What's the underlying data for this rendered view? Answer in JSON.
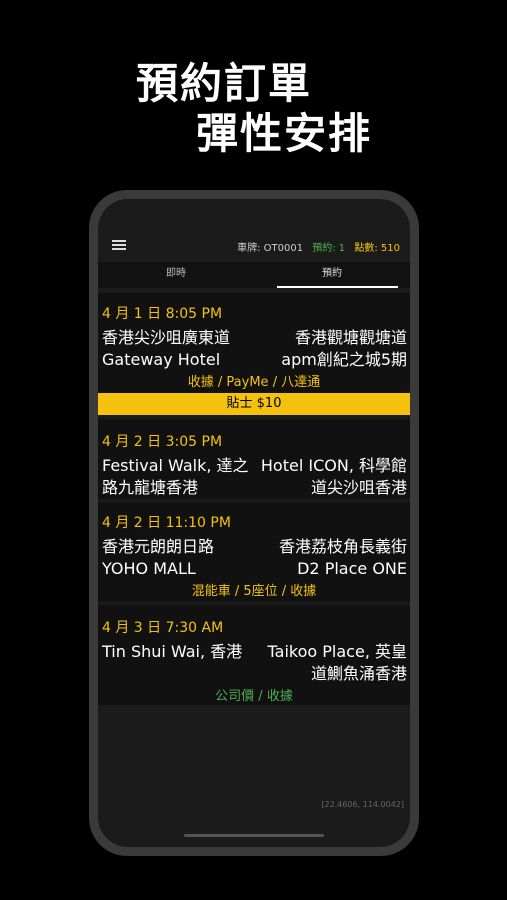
{
  "promo": {
    "line1": "預約訂單",
    "line2": "彈性安排"
  },
  "header": {
    "plate_label": "車牌: OT0001",
    "booking_count": "預約: 1",
    "points": "點數: 510"
  },
  "tabs": [
    {
      "label": "即時"
    },
    {
      "label": "預約"
    }
  ],
  "orders": [
    {
      "date": "4 月 1 日 8:05 PM",
      "from": "香港尖沙咀廣東道 Gateway Hotel",
      "to": "香港觀塘觀塘道 apm創紀之城5期",
      "tags": "收據 / PayMe / 八達通",
      "tip": "貼士 $10"
    },
    {
      "date": "4 月 2 日 3:05 PM",
      "from": "Festival Walk, 達之路九龍塘香港",
      "to": "Hotel ICON, 科學館道尖沙咀香港",
      "tags": ""
    },
    {
      "date": "4 月 2 日 11:10 PM",
      "from": "香港元朗朗日路 YOHO MALL",
      "to": "香港荔枝角長義街D2 Place ONE",
      "tags": "混能車 / 5座位 / 收據"
    },
    {
      "date": "4 月 3 日 7:30 AM",
      "from": "Tin Shui Wai, 香港",
      "to": "Taikoo Place, 英皇道鰂魚涌香港",
      "tags": "公司價 / 收據"
    }
  ],
  "coords": "[22.4606, 114.0042]",
  "colors": {
    "accent_yellow": "#f4c20d",
    "accent_green": "#4caf50",
    "background": "#000000"
  }
}
